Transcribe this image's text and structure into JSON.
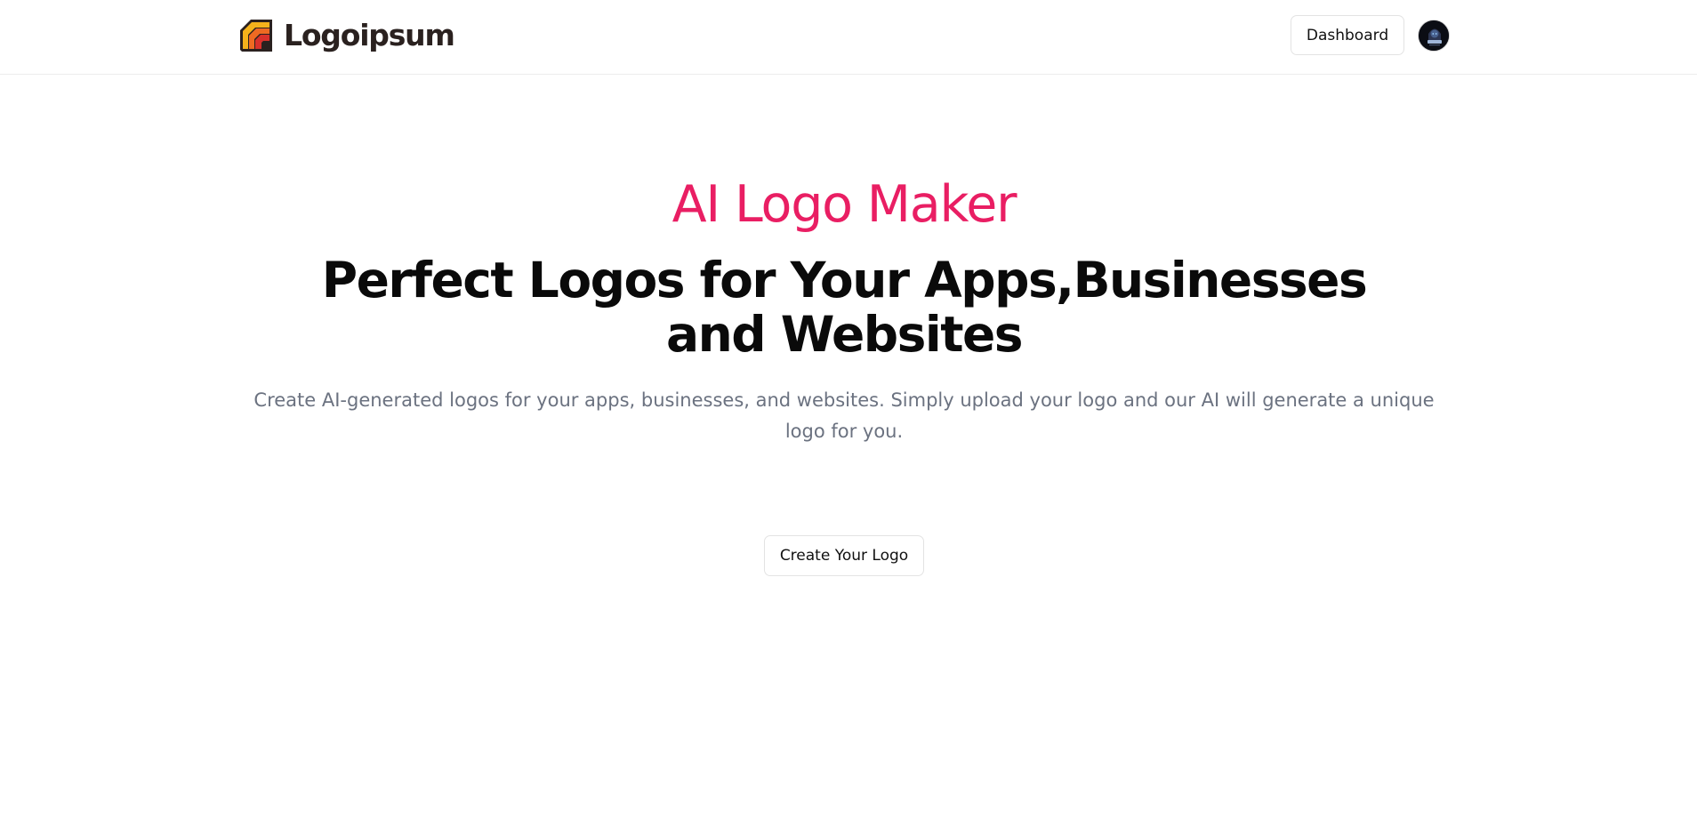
{
  "header": {
    "brand_name": "Logoipsum",
    "brand_icon": "logo-mark-icon",
    "dashboard_label": "Dashboard",
    "avatar_icon": "user-avatar"
  },
  "hero": {
    "eyebrow": "AI Logo Maker",
    "title": "Perfect Logos for Your Apps,Businesses and Websites",
    "description": "Create AI-generated logos for your apps, businesses, and websites. Simply upload your logo and our AI will generate a unique logo for you.",
    "cta_label": "Create Your Logo"
  },
  "colors": {
    "accent": "#e91e63",
    "title": "#0a0a0a",
    "muted": "#6b7280",
    "border": "#e3e3e3",
    "logo_yellow": "#f5b21b",
    "logo_orange": "#ee6a22",
    "logo_red": "#d9312b",
    "logo_dark": "#2a211f"
  }
}
